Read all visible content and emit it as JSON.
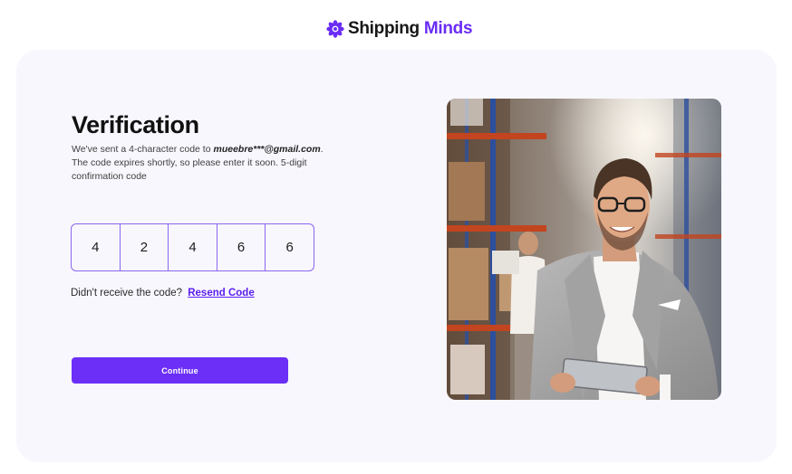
{
  "brand": {
    "name_part1": "Shipping",
    "name_part2": "Minds",
    "accent_color": "#6a2cf5",
    "logo_icon": "flower-burst-icon"
  },
  "verification": {
    "title": "Verification",
    "line1_prefix": "We've sent a 4-character code to ",
    "email": "mueebre***@gmail.com",
    "line1_suffix": ".",
    "line2": "The code expires shortly, so please enter it soon. 5-digit confirmation code"
  },
  "otp": {
    "digits": [
      "4",
      "2",
      "4",
      "6",
      "6"
    ]
  },
  "resend": {
    "prompt": "Didn't receive the code?",
    "link_label": "Resend Code"
  },
  "actions": {
    "continue_label": "Continue",
    "button_color": "#6b2ff7"
  },
  "photo": {
    "icon": "warehouse-man-with-tablet-photo"
  }
}
